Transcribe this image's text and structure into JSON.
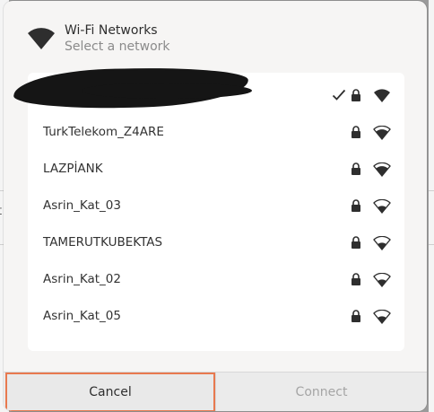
{
  "dialog": {
    "title": "Wi-Fi Networks",
    "subtitle": "Select a network"
  },
  "background": {
    "fragment_text": "t"
  },
  "networks": [
    {
      "name": "",
      "redacted": true,
      "connected": true,
      "secured": true,
      "signal": "excellent"
    },
    {
      "name": "TurkTelekom_Z4ARE",
      "connected": false,
      "secured": true,
      "signal": "good"
    },
    {
      "name": "LAZPİANK",
      "connected": false,
      "secured": true,
      "signal": "good"
    },
    {
      "name": "Asrin_Kat_03",
      "connected": false,
      "secured": true,
      "signal": "ok"
    },
    {
      "name": "TAMERUTKUBEKTAS",
      "connected": false,
      "secured": true,
      "signal": "ok"
    },
    {
      "name": "Asrin_Kat_02",
      "connected": false,
      "secured": true,
      "signal": "ok"
    },
    {
      "name": "Asrin_Kat_05",
      "connected": false,
      "secured": true,
      "signal": "ok"
    }
  ],
  "buttons": {
    "cancel": "Cancel",
    "connect": "Connect"
  },
  "colors": {
    "focus_ring": "#e8794f",
    "icon": "#2e2e2e",
    "disabled_text": "#a5a5a5"
  }
}
